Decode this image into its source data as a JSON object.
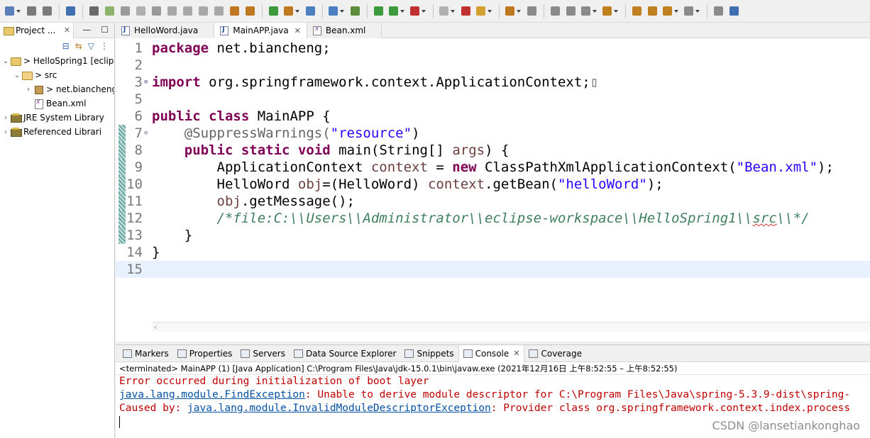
{
  "toolbar": {
    "icons": [
      "new-icon",
      "save-icon",
      "save-all-icon",
      "open-type-icon",
      "skip-breakpoints-icon",
      "resume-icon",
      "suspend-icon",
      "terminate-icon",
      "disconnect-icon",
      "step-into-icon",
      "step-over-icon",
      "step-return-icon",
      "drop-to-frame-icon",
      "use-step-filters-icon",
      "connect-icon",
      "new-server-icon",
      "new-java-project-icon",
      "open-web-browser-icon",
      "search-icon",
      "debug-icon",
      "run-icon",
      "run-last-tool-icon",
      "coverage-icon",
      "stop-icon",
      "new-task-icon",
      "open-folder-icon",
      "external-tools-icon",
      "toggle-mark-occurrences-icon",
      "toggle-word-wrap-icon",
      "block-selection-icon",
      "show-whitespace-icon",
      "next-annotation-icon",
      "prev-annotation-icon",
      "last-edit-location-icon",
      "back-icon",
      "forward-icon",
      "pin-editor-icon",
      "open-perspective-icon"
    ]
  },
  "left_panel": {
    "tab_label": "Project ...",
    "tree": [
      {
        "level": 0,
        "arrow": "expanded",
        "icon": "project-icon",
        "label": "> HelloSpring1 [eclip"
      },
      {
        "level": 1,
        "arrow": "expanded",
        "icon": "source-folder-icon",
        "label": "> src"
      },
      {
        "level": 2,
        "arrow": "collapsed",
        "icon": "package-icon",
        "label": "> net.biancheng"
      },
      {
        "level": 2,
        "arrow": "none",
        "icon": "xml-file-icon",
        "label": "Bean.xml"
      },
      {
        "level": 0,
        "arrow": "collapsed",
        "icon": "library-icon",
        "label": "JRE System Library"
      },
      {
        "level": 0,
        "arrow": "collapsed",
        "icon": "library-icon",
        "label": "Referenced Librari"
      }
    ]
  },
  "editor": {
    "tabs": [
      {
        "label": "HelloWord.java",
        "type": "java",
        "active": false,
        "closable": false
      },
      {
        "label": "MainAPP.java",
        "type": "java",
        "active": true,
        "closable": true
      },
      {
        "label": "Bean.xml",
        "type": "xml",
        "active": false,
        "closable": false
      }
    ],
    "lines": [
      {
        "num": "1",
        "changed": false,
        "fold": "",
        "tokens": [
          {
            "t": "package",
            "c": "kw"
          },
          {
            "t": " net.biancheng;",
            "c": ""
          }
        ]
      },
      {
        "num": "2",
        "changed": false,
        "fold": "",
        "tokens": []
      },
      {
        "num": "3",
        "changed": false,
        "fold": "⊕",
        "tokens": [
          {
            "t": "import",
            "c": "kw"
          },
          {
            "t": " org.springframework.context.ApplicationContext;",
            "c": ""
          },
          {
            "t": "▯",
            "c": "ann"
          }
        ]
      },
      {
        "num": "5",
        "changed": false,
        "fold": "",
        "tokens": []
      },
      {
        "num": "6",
        "changed": false,
        "fold": "",
        "tokens": [
          {
            "t": "public",
            "c": "kw"
          },
          {
            "t": " ",
            "c": ""
          },
          {
            "t": "class",
            "c": "kw"
          },
          {
            "t": " MainAPP {",
            "c": ""
          }
        ]
      },
      {
        "num": "7",
        "changed": true,
        "fold": "⊖",
        "tokens": [
          {
            "t": "    @SuppressWarnings(",
            "c": "ann"
          },
          {
            "t": "\"resource\"",
            "c": "str"
          },
          {
            "t": ")",
            "c": ""
          }
        ]
      },
      {
        "num": "8",
        "changed": true,
        "fold": "",
        "tokens": [
          {
            "t": "    ",
            "c": ""
          },
          {
            "t": "public",
            "c": "kw"
          },
          {
            "t": " ",
            "c": ""
          },
          {
            "t": "static",
            "c": "kw"
          },
          {
            "t": " ",
            "c": ""
          },
          {
            "t": "void",
            "c": "kw"
          },
          {
            "t": " main(String[] ",
            "c": ""
          },
          {
            "t": "args",
            "c": "var"
          },
          {
            "t": ") {",
            "c": ""
          }
        ]
      },
      {
        "num": "9",
        "changed": true,
        "fold": "",
        "tokens": [
          {
            "t": "        ApplicationContext ",
            "c": ""
          },
          {
            "t": "context",
            "c": "var"
          },
          {
            "t": " = ",
            "c": ""
          },
          {
            "t": "new",
            "c": "kw"
          },
          {
            "t": " ClassPathXmlApplicationContext(",
            "c": ""
          },
          {
            "t": "\"Bean.xml\"",
            "c": "str"
          },
          {
            "t": ");",
            "c": ""
          }
        ]
      },
      {
        "num": "10",
        "changed": true,
        "fold": "",
        "tokens": [
          {
            "t": "        HelloWord ",
            "c": ""
          },
          {
            "t": "obj",
            "c": "var"
          },
          {
            "t": "=(HelloWord) ",
            "c": ""
          },
          {
            "t": "context",
            "c": "var"
          },
          {
            "t": ".getBean(",
            "c": ""
          },
          {
            "t": "\"helloWord\"",
            "c": "str"
          },
          {
            "t": ");",
            "c": ""
          }
        ]
      },
      {
        "num": "11",
        "changed": true,
        "fold": "",
        "tokens": [
          {
            "t": "        ",
            "c": ""
          },
          {
            "t": "obj",
            "c": "var"
          },
          {
            "t": ".getMessage();",
            "c": ""
          }
        ]
      },
      {
        "num": "12",
        "changed": true,
        "fold": "",
        "tokens": [
          {
            "t": "        /*file:C:\\\\Users\\\\Administrator\\\\eclipse-workspace\\\\HelloSpring1\\\\",
            "c": "cmt"
          },
          {
            "t": "src",
            "c": "cmt cwave"
          },
          {
            "t": "\\\\*/",
            "c": "cmt"
          }
        ]
      },
      {
        "num": "13",
        "changed": true,
        "fold": "",
        "tokens": [
          {
            "t": "    }",
            "c": ""
          }
        ]
      },
      {
        "num": "14",
        "changed": false,
        "fold": "",
        "tokens": [
          {
            "t": "}",
            "c": ""
          }
        ]
      },
      {
        "num": "15",
        "changed": false,
        "fold": "",
        "current": true,
        "tokens": []
      }
    ]
  },
  "console": {
    "tabs": [
      {
        "label": "Markers",
        "active": false
      },
      {
        "label": "Properties",
        "active": false
      },
      {
        "label": "Servers",
        "active": false
      },
      {
        "label": "Data Source Explorer",
        "active": false
      },
      {
        "label": "Snippets",
        "active": false
      },
      {
        "label": "Console",
        "active": true
      },
      {
        "label": "Coverage",
        "active": false
      }
    ],
    "status": "<terminated> MainAPP (1) [Java Application] C:\\Program Files\\Java\\jdk-15.0.1\\bin\\javaw.exe  (2021年12月16日 上午8:52:55 – 上午8:52:55)",
    "lines": [
      [
        {
          "t": "Error occurred during initialization of boot layer",
          "c": "err"
        }
      ],
      [
        {
          "t": "java.lang.module.FindException",
          "c": "lnk"
        },
        {
          "t": ": Unable to derive module descriptor for C:\\Program Files\\Java\\spring-5.3.9-dist\\spring-",
          "c": "err"
        }
      ],
      [
        {
          "t": "Caused by: ",
          "c": "err"
        },
        {
          "t": "java.lang.module.InvalidModuleDescriptorException",
          "c": "lnk"
        },
        {
          "t": ": Provider class org.springframework.context.index.process",
          "c": "err"
        }
      ]
    ]
  },
  "watermark": "CSDN @lansetiankonghao"
}
